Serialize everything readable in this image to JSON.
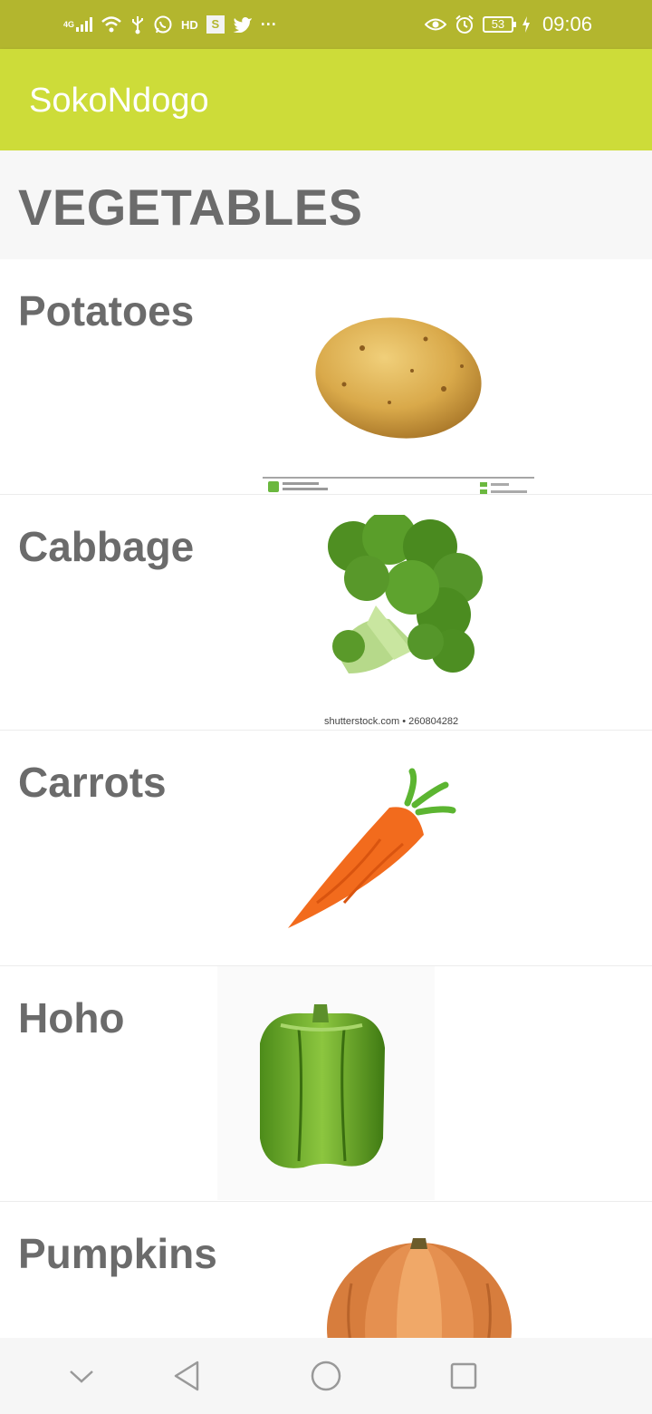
{
  "status_bar": {
    "network_label": "4G",
    "hd_label": "HD",
    "s_label": "S",
    "more_label": "···",
    "battery_level": "53",
    "time": "09:06",
    "icons": [
      "signal-icon",
      "wifi-icon",
      "usb-icon",
      "whatsapp-icon",
      "twitter-icon",
      "eye-icon",
      "alarm-icon",
      "battery-icon",
      "charging-icon"
    ]
  },
  "app_bar": {
    "title": "SokoNdogo"
  },
  "section": {
    "heading": "VEGETABLES"
  },
  "vegetables": [
    {
      "name": "Potatoes",
      "image": "potato-image"
    },
    {
      "name": "Cabbage",
      "image": "broccoli-image",
      "watermark": "shutterstock.com • 260804282"
    },
    {
      "name": "Carrots",
      "image": "carrot-image"
    },
    {
      "name": "Hoho",
      "image": "green-pepper-image"
    },
    {
      "name": "Pumpkins",
      "image": "pumpkin-image"
    }
  ],
  "nav_bar": {
    "icons": [
      "chevron-down-icon",
      "back-icon",
      "home-icon",
      "recents-icon"
    ]
  },
  "colors": {
    "status_bar": "#b3b62e",
    "app_bar": "#cddc39",
    "text_gray": "#6b6b6b"
  }
}
